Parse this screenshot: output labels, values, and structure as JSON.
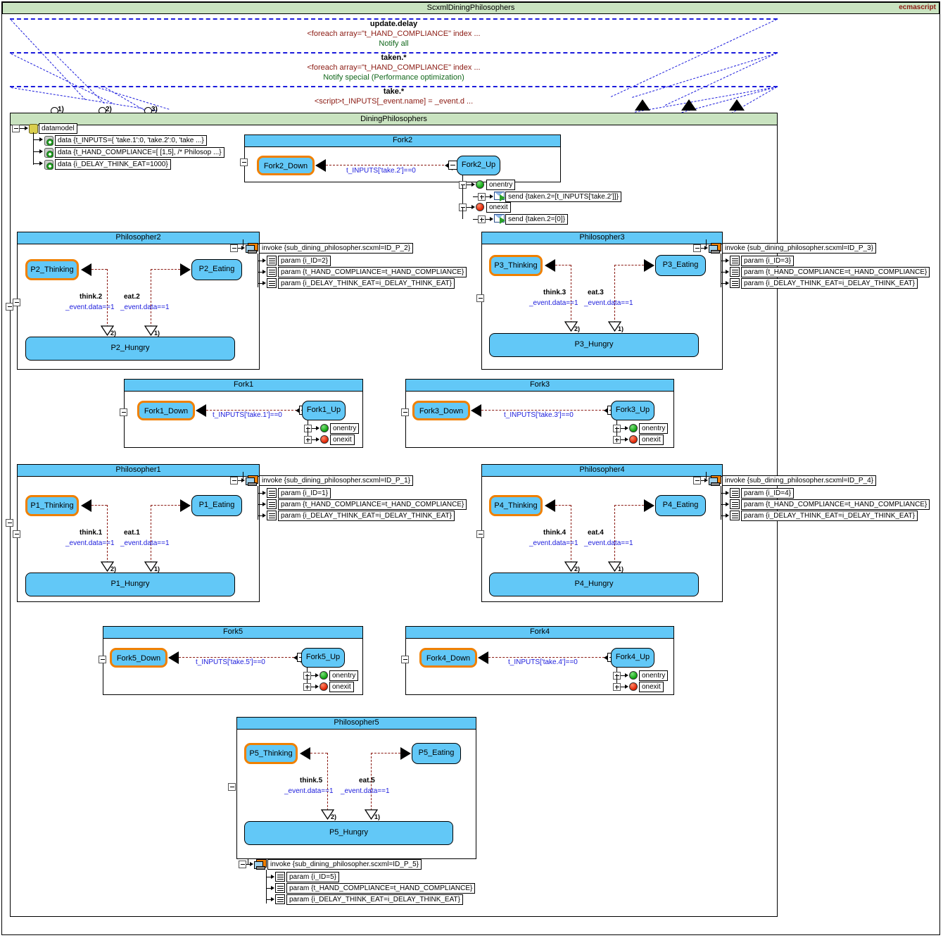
{
  "window": {
    "title": "ScxmlDiningPhilosophers",
    "language": "ecmascript"
  },
  "top_transitions": [
    {
      "event": "update.delay",
      "action": "<foreach array=\"t_HAND_COMPLIANCE\" index ...",
      "note": "Notify all"
    },
    {
      "event": "taken.*",
      "action": "<foreach array=\"t_HAND_COMPLIANCE\" index ...",
      "note": "Notify special (Performance optimization)"
    },
    {
      "event": "take.*",
      "action": "<script>t_INPUTS[_event.name] = _event.d ...",
      "note": ""
    }
  ],
  "main_region": {
    "title": "DiningPhilosophers",
    "entry_points": [
      "1)",
      "2)",
      "3)"
    ]
  },
  "datamodel": {
    "label": "datamodel",
    "entries": [
      "data {t_INPUTS={ 'take.1':0, 'take.2':0, 'take ...}",
      "data {t_HAND_COMPLIANCE=[   [1,5], /* Philosop ...}",
      "data {i_DELAY_THINK_EAT=1000}"
    ]
  },
  "forks": [
    {
      "name": "Fork2",
      "down_state": "Fork2_Down",
      "up_state": "Fork2_Up",
      "guard": "t_INPUTS['take.2']==0",
      "onentry_label": "onentry",
      "onexit_label": "onexit",
      "onentry_action": "send {taken.2=[t_INPUTS['take.2']]}",
      "onexit_action": "send {taken.2=[0]}",
      "expanded": true
    },
    {
      "name": "Fork1",
      "down_state": "Fork1_Down",
      "up_state": "Fork1_Up",
      "guard": "t_INPUTS['take.1']==0",
      "onentry_label": "onentry",
      "onexit_label": "onexit",
      "expanded": false
    },
    {
      "name": "Fork3",
      "down_state": "Fork3_Down",
      "up_state": "Fork3_Up",
      "guard": "t_INPUTS['take.3']==0",
      "onentry_label": "onentry",
      "onexit_label": "onexit",
      "expanded": false
    },
    {
      "name": "Fork5",
      "down_state": "Fork5_Down",
      "up_state": "Fork5_Up",
      "guard": "t_INPUTS['take.5']==0",
      "onentry_label": "onentry",
      "onexit_label": "onexit",
      "expanded": false
    },
    {
      "name": "Fork4",
      "down_state": "Fork4_Down",
      "up_state": "Fork4_Up",
      "guard": "t_INPUTS['take.4']==0",
      "onentry_label": "onentry",
      "onexit_label": "onexit",
      "expanded": false
    }
  ],
  "philosophers": [
    {
      "name": "Philosopher2",
      "thinking": "P2_Thinking",
      "eating": "P2_Eating",
      "hungry": "P2_Hungry",
      "think_event": "think.2",
      "eat_event": "eat.2",
      "think_guard": "_event.data==1",
      "eat_guard": "_event.data==1",
      "junction_left": "2)",
      "junction_right": "1)",
      "invoke": "invoke {sub_dining_philosopher.scxml=ID_P_2}",
      "params": [
        "param {i_ID=2}",
        "param {t_HAND_COMPLIANCE=t_HAND_COMPLIANCE}",
        "param {i_DELAY_THINK_EAT=i_DELAY_THINK_EAT}"
      ]
    },
    {
      "name": "Philosopher3",
      "thinking": "P3_Thinking",
      "eating": "P3_Eating",
      "hungry": "P3_Hungry",
      "think_event": "think.3",
      "eat_event": "eat.3",
      "think_guard": "_event.data==1",
      "eat_guard": "_event.data==1",
      "junction_left": "2)",
      "junction_right": "1)",
      "invoke": "invoke {sub_dining_philosopher.scxml=ID_P_3}",
      "params": [
        "param {i_ID=3}",
        "param {t_HAND_COMPLIANCE=t_HAND_COMPLIANCE}",
        "param {i_DELAY_THINK_EAT=i_DELAY_THINK_EAT}"
      ]
    },
    {
      "name": "Philosopher1",
      "thinking": "P1_Thinking",
      "eating": "P1_Eating",
      "hungry": "P1_Hungry",
      "think_event": "think.1",
      "eat_event": "eat.1",
      "think_guard": "_event.data==1",
      "eat_guard": "_event.data==1",
      "junction_left": "2)",
      "junction_right": "1)",
      "invoke": "invoke {sub_dining_philosopher.scxml=ID_P_1}",
      "params": [
        "param {i_ID=1}",
        "param {t_HAND_COMPLIANCE=t_HAND_COMPLIANCE}",
        "param {i_DELAY_THINK_EAT=i_DELAY_THINK_EAT}"
      ]
    },
    {
      "name": "Philosopher4",
      "thinking": "P4_Thinking",
      "eating": "P4_Eating",
      "hungry": "P4_Hungry",
      "think_event": "think.4",
      "eat_event": "eat.4",
      "think_guard": "_event.data==1",
      "eat_guard": "_event.data==1",
      "junction_left": "2)",
      "junction_right": "1)",
      "invoke": "invoke {sub_dining_philosopher.scxml=ID_P_4}",
      "params": [
        "param {i_ID=4}",
        "param {t_HAND_COMPLIANCE=t_HAND_COMPLIANCE}",
        "param {i_DELAY_THINK_EAT=i_DELAY_THINK_EAT}"
      ]
    },
    {
      "name": "Philosopher5",
      "thinking": "P5_Thinking",
      "eating": "P5_Eating",
      "hungry": "P5_Hungry",
      "think_event": "think.5",
      "eat_event": "eat.5",
      "think_guard": "_event.data==1",
      "eat_guard": "_event.data==1",
      "junction_left": "2)",
      "junction_right": "1)",
      "invoke": "invoke {sub_dining_philosopher.scxml=ID_P_5}",
      "params": [
        "param {i_ID=5}",
        "param {t_HAND_COMPLIANCE=t_HAND_COMPLIANCE}",
        "param {i_DELAY_THINK_EAT=i_DELAY_THINK_EAT}"
      ]
    }
  ],
  "colors": {
    "header_green": "#c9e3c0",
    "state_blue": "#62c8f7",
    "initial_orange": "#f08000",
    "transition_red": "#8b1a12",
    "guard_blue": "#1b1bdc",
    "note_green": "#11671b"
  }
}
